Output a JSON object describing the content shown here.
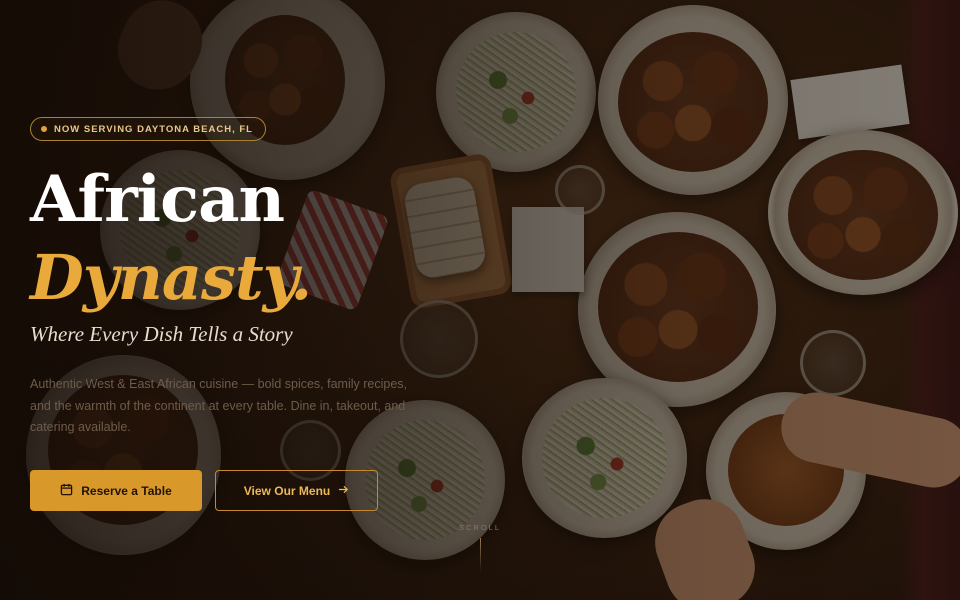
{
  "hero": {
    "badge": "NOW SERVING DAYTONA BEACH, FL",
    "title_line1": "African",
    "title_line2": "Dynasty.",
    "tagline": "Where Every Dish Tells a Story",
    "description": "Authentic West & East African cuisine — bold spices, family recipes, and the warmth of the continent at every table. Dine in, takeout, and catering available.",
    "primary_button": "Reserve a Table",
    "secondary_button": "View Our Menu",
    "scroll_label": "SCROLL"
  },
  "colors": {
    "accent": "#e9aa3b",
    "button_primary": "#d8992a",
    "title": "#ffffff"
  },
  "icons": {
    "badge": "dot-icon",
    "primary_button": "calendar-icon",
    "secondary_button": "arrow-right-icon"
  }
}
